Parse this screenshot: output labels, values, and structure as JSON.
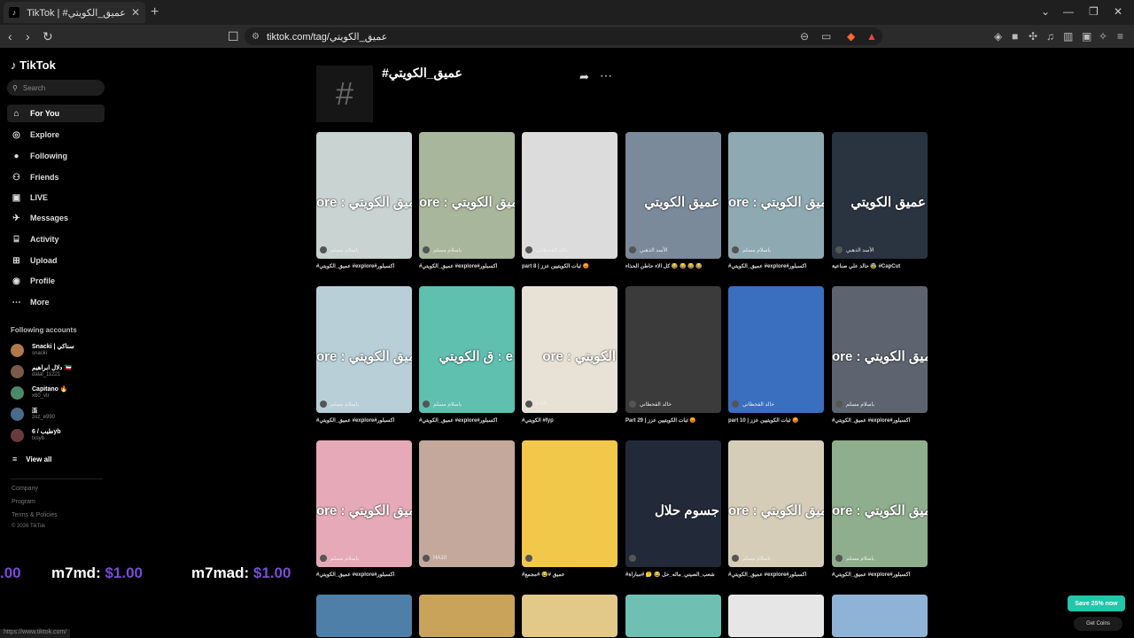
{
  "browser": {
    "tab_title": "TikTok | #عميق_الكويتي",
    "url": "tiktok.com/tag/عميق_الكويتي"
  },
  "sidebar": {
    "logo": "TikTok",
    "search_placeholder": "Search",
    "nav": [
      {
        "label": "For You",
        "icon": "home-icon"
      },
      {
        "label": "Explore",
        "icon": "compass-icon"
      },
      {
        "label": "Following",
        "icon": "avatar-icon"
      },
      {
        "label": "Friends",
        "icon": "friends-icon"
      },
      {
        "label": "LIVE",
        "icon": "live-icon"
      },
      {
        "label": "Messages",
        "icon": "paper-plane-icon"
      },
      {
        "label": "Activity",
        "icon": "inbox-icon"
      },
      {
        "label": "Upload",
        "icon": "plus-square-icon"
      },
      {
        "label": "Profile",
        "icon": "profile-icon"
      },
      {
        "label": "More",
        "icon": "ellipsis-icon"
      }
    ],
    "following_header": "Following accounts",
    "accounts": [
      {
        "name": "Snacki | سناكي",
        "handle": "snacki"
      },
      {
        "name": "دلال ابراهيم 🇰🇼",
        "handle": "dalal_11221"
      },
      {
        "name": "Capitano 🔥",
        "handle": "x60_vtr"
      },
      {
        "name": "🇧",
        "handle": "zoz_e990"
      },
      {
        "name": "طيب / 6yb",
        "handle": "txsyb"
      }
    ],
    "view_all": "View all",
    "footer": [
      "Company",
      "Program",
      "Terms & Policies",
      "© 2026 TikTok"
    ]
  },
  "main": {
    "tag_title": "#عميق_الكويتي",
    "videos": [
      {
        "overlay": "ore : عميق الكويتي",
        "author": "ياسلام مسلم",
        "caption": "#عميق_الكويتي #explore#اكسبلور",
        "bg": "#c9d3d1"
      },
      {
        "overlay": "ore : عميق الكويتي",
        "author": "ياسلام مسلم",
        "caption": "#عميق_الكويتي #explore#اكسبلور",
        "bg": "#a8b79b"
      },
      {
        "overlay": "",
        "author": "خالد القحطاني",
        "caption": "part 8 | ثبات الكويتيين عزز 😡",
        "bg": "#dcdcdc"
      },
      {
        "overlay": "عميق الكويتي",
        "author": "الأسد الذهبي",
        "caption": "كل الاء حاطن الحذاء 😂 😂 😂 😂",
        "bg": "#7a8a9a"
      },
      {
        "overlay": "ore : عميق الكويتي",
        "author": "ياسلام مسلم",
        "caption": "#عميق_الكويتي #explore#اكسبلور",
        "bg": "#8fa9b3"
      },
      {
        "overlay": "عميق الكويتي",
        "author": "الأسد الذهبي",
        "caption": "حالد علي صناعية 🥸 #CapCut",
        "bg": "#2a3440"
      },
      {
        "overlay": "ore : عميق الكويتي",
        "author": "ياسلام مسلم",
        "caption": "#عميق_الكويتي #explore#اكسبلور",
        "bg": "#b8cfd8"
      },
      {
        "overlay": "ق الكويتي : e",
        "author": "ياسلام مسلم",
        "caption": "#عميق_الكويتي #explore#اكسبلور",
        "bg": "#5fc0b0"
      },
      {
        "overlay": "ore : الكويتي",
        "author": "Lsf4",
        "caption": "#الكويتي #fyp",
        "bg": "#e8e2d6"
      },
      {
        "overlay": "",
        "author": "خالد القحطاني",
        "caption": "Part 29 | ثبات الكويتيين عزز 😡",
        "bg": "#3b3b3b"
      },
      {
        "overlay": "",
        "author": "خالد القحطاني",
        "caption": "part 10 | ثبات الكويتيين عزز 😡",
        "bg": "#3a6fc0"
      },
      {
        "overlay": "ore : عميق الكويتي",
        "author": "ياسلام مسلم",
        "caption": "#عميق_الكويتي #explore#اكسبلور",
        "bg": "#5d6470"
      },
      {
        "overlay": "ore : عميق الكويتي",
        "author": "ياسلام مسلم",
        "caption": "#عميق_الكويتي #explore#اكسبلور",
        "bg": "#e6a9b7"
      },
      {
        "overlay": "",
        "author": "HA10",
        "caption": "",
        "bg": "#c4a89b"
      },
      {
        "overlay": "",
        "author": "",
        "caption": "#عميق #😂 #مجمع",
        "bg": "#f2c84a"
      },
      {
        "overlay": "جسوم حلال",
        "author": "",
        "caption": "#شعب_الصيني_ماله_حل 😂 🤔 #مباراة",
        "bg": "#222a3a"
      },
      {
        "overlay": "ore : عميق الكويتي",
        "author": "ياسلام مسلم",
        "caption": "#عميق_الكويتي #explore#اكسبلور",
        "bg": "#d6cdb9"
      },
      {
        "overlay": "ore : عميق الكويتي",
        "author": "ياسلام مسلم",
        "caption": "#عميق_الكويتي #explore#اكسبلور",
        "bg": "#8fae8d"
      }
    ],
    "bottom_row_bgs": [
      "#4e7fa8",
      "#c9a35a",
      "#e2c889",
      "#6fc0b3",
      "#e6e6e6",
      "#8fb3d6"
    ]
  },
  "stream_overlay": {
    "left": ".00",
    "m7md": "m7md:",
    "m7md_val": "$1.00",
    "m7mad": "m7mad:",
    "m7mad_val": "$1.00"
  },
  "buttons": {
    "save": "Save 25% now",
    "coins": "Get Coins"
  },
  "status_url": "https://www.tiktok.com/"
}
